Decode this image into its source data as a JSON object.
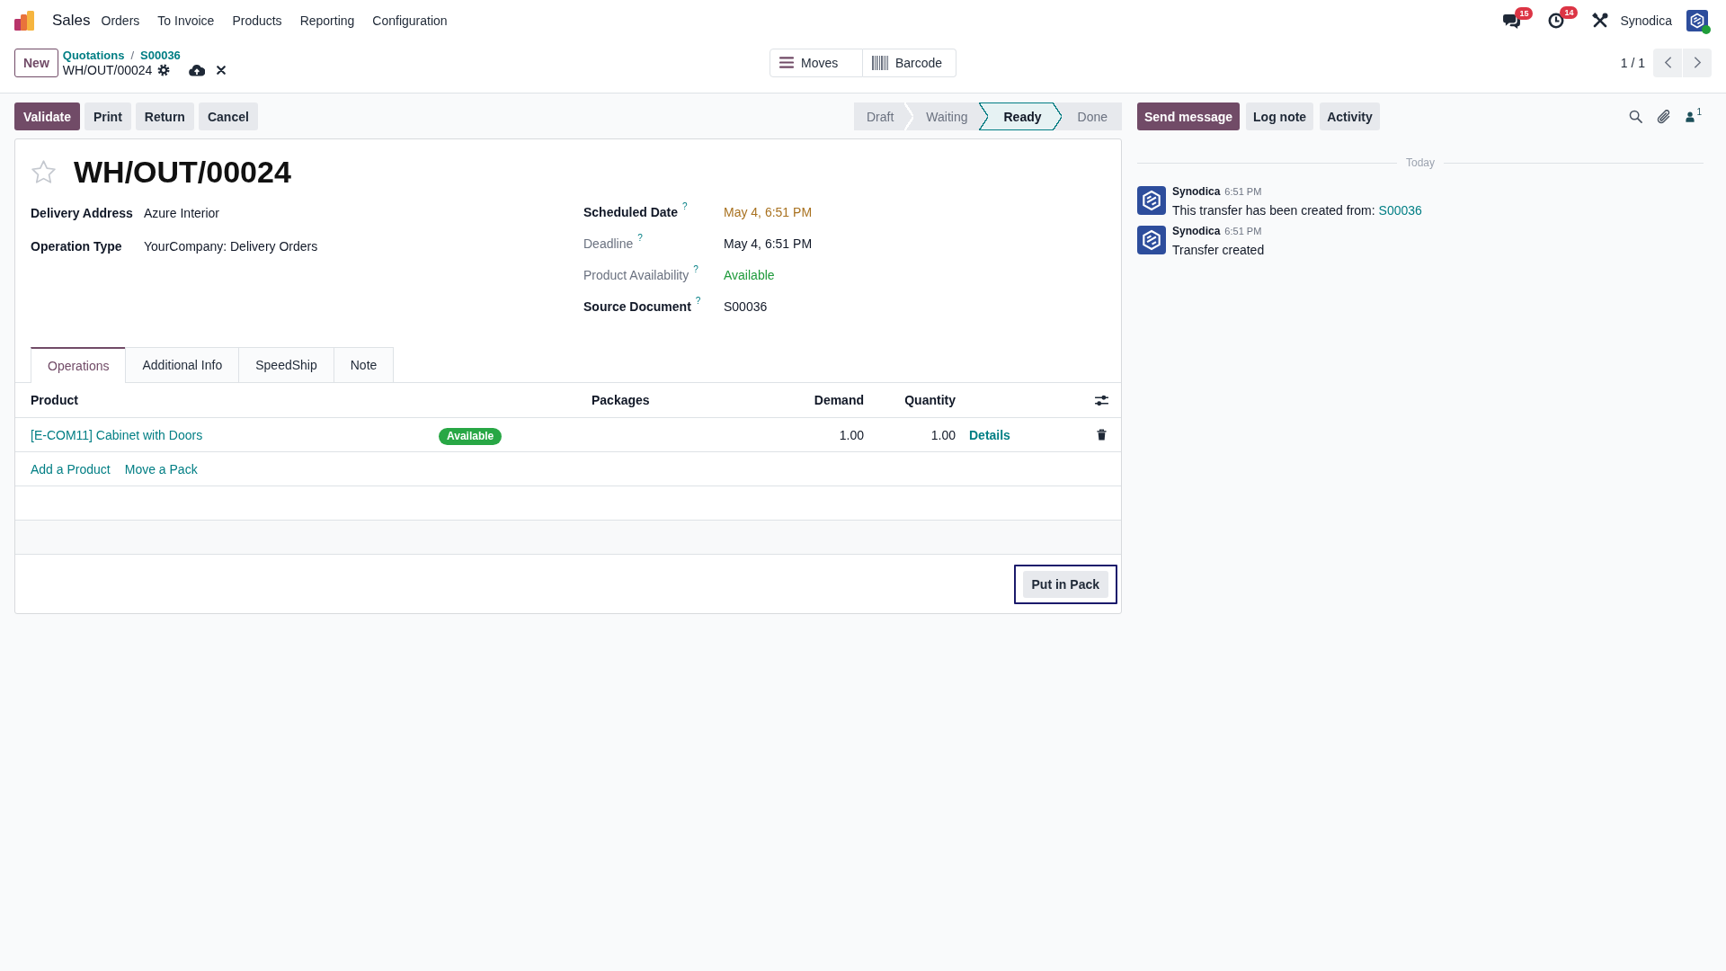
{
  "navbar": {
    "app_name": "Sales",
    "menu": [
      "Orders",
      "To Invoice",
      "Products",
      "Reporting",
      "Configuration"
    ],
    "systray": {
      "messages_badge": "15",
      "activities_badge": "14",
      "user_name": "Synodica",
      "user_online": true
    }
  },
  "control_panel": {
    "new_button": "New",
    "breadcrumbs": [
      "Quotations",
      "S00036"
    ],
    "breadcrumb_separator": "/",
    "record_name": "WH/OUT/00024",
    "view_buttons": [
      {
        "label": "Moves",
        "kind": "list"
      },
      {
        "label": "Barcode",
        "kind": "barcode"
      }
    ],
    "pager": "1 / 1"
  },
  "action_buttons": [
    {
      "label": "Validate",
      "kind": "primary"
    },
    {
      "label": "Print",
      "kind": "secondary"
    },
    {
      "label": "Return",
      "kind": "secondary"
    },
    {
      "label": "Cancel",
      "kind": "secondary"
    }
  ],
  "status_stages": [
    {
      "label": "Draft",
      "selected": false
    },
    {
      "label": "Waiting",
      "selected": false
    },
    {
      "label": "Ready",
      "selected": true
    },
    {
      "label": "Done",
      "selected": false
    }
  ],
  "form": {
    "starred": false,
    "title": "WH/OUT/00024",
    "left_fields": [
      {
        "label": "Delivery Address",
        "value": "Azure Interior",
        "readonly": false
      },
      {
        "label": "Operation Type",
        "value": "YourCompany: Delivery Orders",
        "readonly": false
      }
    ],
    "right_fields": [
      {
        "label": "Scheduled Date",
        "help": "?",
        "value": "May 4, 6:51 PM",
        "readonly": false,
        "kind": "warning"
      },
      {
        "label": "Deadline",
        "help": "?",
        "value": "May 4, 6:51 PM",
        "readonly": true,
        "kind": "plain"
      },
      {
        "label": "Product Availability",
        "help": "?",
        "value": "Available",
        "readonly": true,
        "kind": "success"
      },
      {
        "label": "Source Document",
        "help": "?",
        "value": "S00036",
        "readonly": false,
        "kind": "plain"
      }
    ],
    "tabs": [
      {
        "label": "Operations",
        "selected": true
      },
      {
        "label": "Additional Info",
        "selected": false
      },
      {
        "label": "SpeedShip",
        "selected": false
      },
      {
        "label": "Note",
        "selected": false
      }
    ],
    "table": {
      "columns": [
        "Product",
        "Packages",
        "Demand",
        "Quantity"
      ],
      "rows": [
        {
          "product": "[E-COM11] Cabinet with Doors",
          "availability": "Available",
          "demand": "1.00",
          "quantity": "1.00",
          "details": "Details"
        }
      ],
      "add_links": [
        "Add a Product",
        "Move a Pack"
      ]
    },
    "footer_button": {
      "label": "Put in Pack",
      "focused": true
    }
  },
  "chatter": {
    "buttons": [
      {
        "label": "Send message",
        "kind": "primary"
      },
      {
        "label": "Log note",
        "kind": "secondary"
      },
      {
        "label": "Activity",
        "kind": "secondary"
      }
    ],
    "followers_count": "1",
    "date_divider": "Today",
    "messages": [
      {
        "author": "Synodica",
        "time": "6:51 PM",
        "body": "This transfer has been created from:",
        "link": "S00036"
      },
      {
        "author": "Synodica",
        "time": "6:51 PM",
        "body": "Transfer created"
      }
    ]
  }
}
